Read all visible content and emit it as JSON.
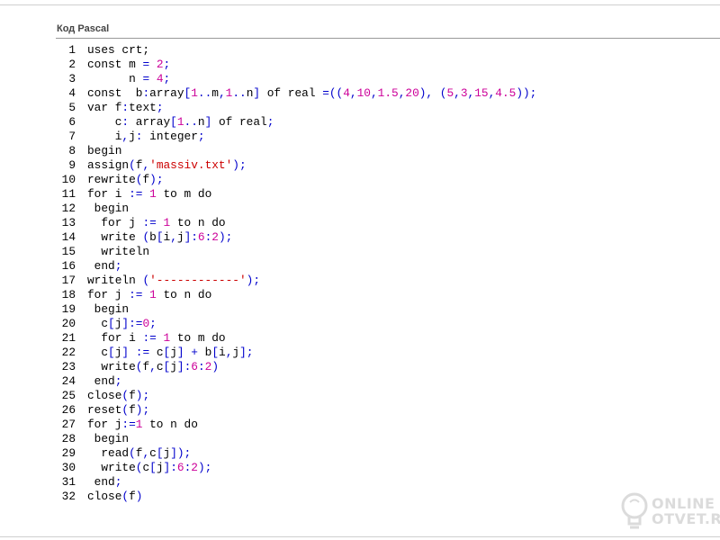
{
  "panel": {
    "title": "Код Pascal"
  },
  "code_lines": [
    [
      [
        "i",
        "uses crt;"
      ]
    ],
    [
      [
        "i",
        "const m "
      ],
      [
        "p",
        "="
      ],
      [
        "i",
        " "
      ],
      [
        "n",
        "2"
      ],
      [
        "p",
        ";"
      ]
    ],
    [
      [
        "i",
        "      n "
      ],
      [
        "p",
        "="
      ],
      [
        "i",
        " "
      ],
      [
        "n",
        "4"
      ],
      [
        "p",
        ";"
      ]
    ],
    [
      [
        "i",
        "const  b"
      ],
      [
        "p",
        ":"
      ],
      [
        "i",
        "array"
      ],
      [
        "p",
        "["
      ],
      [
        "n",
        "1"
      ],
      [
        "p",
        ".."
      ],
      [
        "i",
        "m"
      ],
      [
        "p",
        ","
      ],
      [
        "n",
        "1"
      ],
      [
        "p",
        ".."
      ],
      [
        "i",
        "n"
      ],
      [
        "p",
        "]"
      ],
      [
        "i",
        " of real "
      ],
      [
        "p",
        "=(("
      ],
      [
        "n",
        "4"
      ],
      [
        "p",
        ","
      ],
      [
        "n",
        "10"
      ],
      [
        "p",
        ","
      ],
      [
        "n",
        "1.5"
      ],
      [
        "p",
        ","
      ],
      [
        "n",
        "20"
      ],
      [
        "p",
        "),"
      ],
      [
        "i",
        " "
      ],
      [
        "p",
        "("
      ],
      [
        "n",
        "5"
      ],
      [
        "p",
        ","
      ],
      [
        "n",
        "3"
      ],
      [
        "p",
        ","
      ],
      [
        "n",
        "15"
      ],
      [
        "p",
        ","
      ],
      [
        "n",
        "4.5"
      ],
      [
        "p",
        "));"
      ]
    ],
    [
      [
        "i",
        "var f"
      ],
      [
        "p",
        ":"
      ],
      [
        "i",
        "text"
      ],
      [
        "p",
        ";"
      ]
    ],
    [
      [
        "i",
        "    c"
      ],
      [
        "p",
        ":"
      ],
      [
        "i",
        " array"
      ],
      [
        "p",
        "["
      ],
      [
        "n",
        "1"
      ],
      [
        "p",
        ".."
      ],
      [
        "i",
        "n"
      ],
      [
        "p",
        "]"
      ],
      [
        "i",
        " of real"
      ],
      [
        "p",
        ";"
      ]
    ],
    [
      [
        "i",
        "    i"
      ],
      [
        "p",
        ","
      ],
      [
        "i",
        "j"
      ],
      [
        "p",
        ":"
      ],
      [
        "i",
        " integer"
      ],
      [
        "p",
        ";"
      ]
    ],
    [
      [
        "i",
        "begin"
      ]
    ],
    [
      [
        "i",
        "assign"
      ],
      [
        "p",
        "("
      ],
      [
        "i",
        "f"
      ],
      [
        "p",
        ","
      ],
      [
        "s",
        "'massiv.txt'"
      ],
      [
        "p",
        ");"
      ]
    ],
    [
      [
        "i",
        "rewrite"
      ],
      [
        "p",
        "("
      ],
      [
        "i",
        "f"
      ],
      [
        "p",
        ");"
      ]
    ],
    [
      [
        "i",
        "for i "
      ],
      [
        "p",
        ":="
      ],
      [
        "i",
        " "
      ],
      [
        "n",
        "1"
      ],
      [
        "i",
        " to m do"
      ]
    ],
    [
      [
        "i",
        " begin"
      ]
    ],
    [
      [
        "i",
        "  for j "
      ],
      [
        "p",
        ":="
      ],
      [
        "i",
        " "
      ],
      [
        "n",
        "1"
      ],
      [
        "i",
        " to n do"
      ]
    ],
    [
      [
        "i",
        "  write "
      ],
      [
        "p",
        "("
      ],
      [
        "i",
        "b"
      ],
      [
        "p",
        "["
      ],
      [
        "i",
        "i"
      ],
      [
        "p",
        ","
      ],
      [
        "i",
        "j"
      ],
      [
        "p",
        "]:"
      ],
      [
        "n",
        "6"
      ],
      [
        "p",
        ":"
      ],
      [
        "n",
        "2"
      ],
      [
        "p",
        ");"
      ]
    ],
    [
      [
        "i",
        "  writeln"
      ]
    ],
    [
      [
        "i",
        " end"
      ],
      [
        "p",
        ";"
      ]
    ],
    [
      [
        "i",
        "writeln "
      ],
      [
        "p",
        "("
      ],
      [
        "s",
        "'------------'"
      ],
      [
        "p",
        ");"
      ]
    ],
    [
      [
        "i",
        "for j "
      ],
      [
        "p",
        ":="
      ],
      [
        "i",
        " "
      ],
      [
        "n",
        "1"
      ],
      [
        "i",
        " to n do"
      ]
    ],
    [
      [
        "i",
        " begin"
      ]
    ],
    [
      [
        "i",
        "  c"
      ],
      [
        "p",
        "["
      ],
      [
        "i",
        "j"
      ],
      [
        "p",
        "]:="
      ],
      [
        "n",
        "0"
      ],
      [
        "p",
        ";"
      ]
    ],
    [
      [
        "i",
        "  for i "
      ],
      [
        "p",
        ":="
      ],
      [
        "i",
        " "
      ],
      [
        "n",
        "1"
      ],
      [
        "i",
        " to m do"
      ]
    ],
    [
      [
        "i",
        "  c"
      ],
      [
        "p",
        "["
      ],
      [
        "i",
        "j"
      ],
      [
        "p",
        "]"
      ],
      [
        "i",
        " "
      ],
      [
        "p",
        ":="
      ],
      [
        "i",
        " c"
      ],
      [
        "p",
        "["
      ],
      [
        "i",
        "j"
      ],
      [
        "p",
        "]"
      ],
      [
        "i",
        " "
      ],
      [
        "p",
        "+"
      ],
      [
        "i",
        " b"
      ],
      [
        "p",
        "["
      ],
      [
        "i",
        "i"
      ],
      [
        "p",
        ","
      ],
      [
        "i",
        "j"
      ],
      [
        "p",
        "];"
      ]
    ],
    [
      [
        "i",
        "  write"
      ],
      [
        "p",
        "("
      ],
      [
        "i",
        "f"
      ],
      [
        "p",
        ","
      ],
      [
        "i",
        "c"
      ],
      [
        "p",
        "["
      ],
      [
        "i",
        "j"
      ],
      [
        "p",
        "]:"
      ],
      [
        "n",
        "6"
      ],
      [
        "p",
        ":"
      ],
      [
        "n",
        "2"
      ],
      [
        "p",
        ")"
      ]
    ],
    [
      [
        "i",
        " end"
      ],
      [
        "p",
        ";"
      ]
    ],
    [
      [
        "i",
        "close"
      ],
      [
        "p",
        "("
      ],
      [
        "i",
        "f"
      ],
      [
        "p",
        ");"
      ]
    ],
    [
      [
        "i",
        "reset"
      ],
      [
        "p",
        "("
      ],
      [
        "i",
        "f"
      ],
      [
        "p",
        ");"
      ]
    ],
    [
      [
        "i",
        "for j"
      ],
      [
        "p",
        ":="
      ],
      [
        "n",
        "1"
      ],
      [
        "i",
        " to n do"
      ]
    ],
    [
      [
        "i",
        " begin"
      ]
    ],
    [
      [
        "i",
        "  read"
      ],
      [
        "p",
        "("
      ],
      [
        "i",
        "f"
      ],
      [
        "p",
        ","
      ],
      [
        "i",
        "c"
      ],
      [
        "p",
        "["
      ],
      [
        "i",
        "j"
      ],
      [
        "p",
        "]);"
      ]
    ],
    [
      [
        "i",
        "  write"
      ],
      [
        "p",
        "("
      ],
      [
        "i",
        "c"
      ],
      [
        "p",
        "["
      ],
      [
        "i",
        "j"
      ],
      [
        "p",
        "]:"
      ],
      [
        "n",
        "6"
      ],
      [
        "p",
        ":"
      ],
      [
        "n",
        "2"
      ],
      [
        "p",
        ");"
      ]
    ],
    [
      [
        "i",
        " end"
      ],
      [
        "p",
        ";"
      ]
    ],
    [
      [
        "i",
        "close"
      ],
      [
        "p",
        "("
      ],
      [
        "i",
        "f"
      ],
      [
        "p",
        ")"
      ]
    ]
  ],
  "watermark": {
    "line1": "ONLINE",
    "line2": "OTVET.RU"
  },
  "colors": {
    "number": "#cc0099",
    "string": "#cc0000",
    "punctuation": "#0000cc",
    "text": "#000000"
  },
  "icons": {
    "watermark": "lightbulb-icon"
  }
}
